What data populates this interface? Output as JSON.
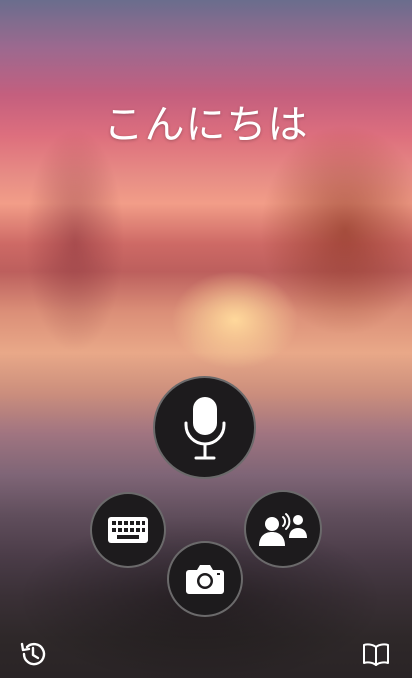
{
  "greeting": "こんにちは",
  "buttons": {
    "microphone": "microphone-icon",
    "keyboard": "keyboard-icon",
    "conversation": "conversation-icon",
    "camera": "camera-icon",
    "history": "history-icon",
    "phrasebook": "phrasebook-icon"
  },
  "colors": {
    "button_fill": "#1d1b1d",
    "icon": "#ffffff"
  }
}
